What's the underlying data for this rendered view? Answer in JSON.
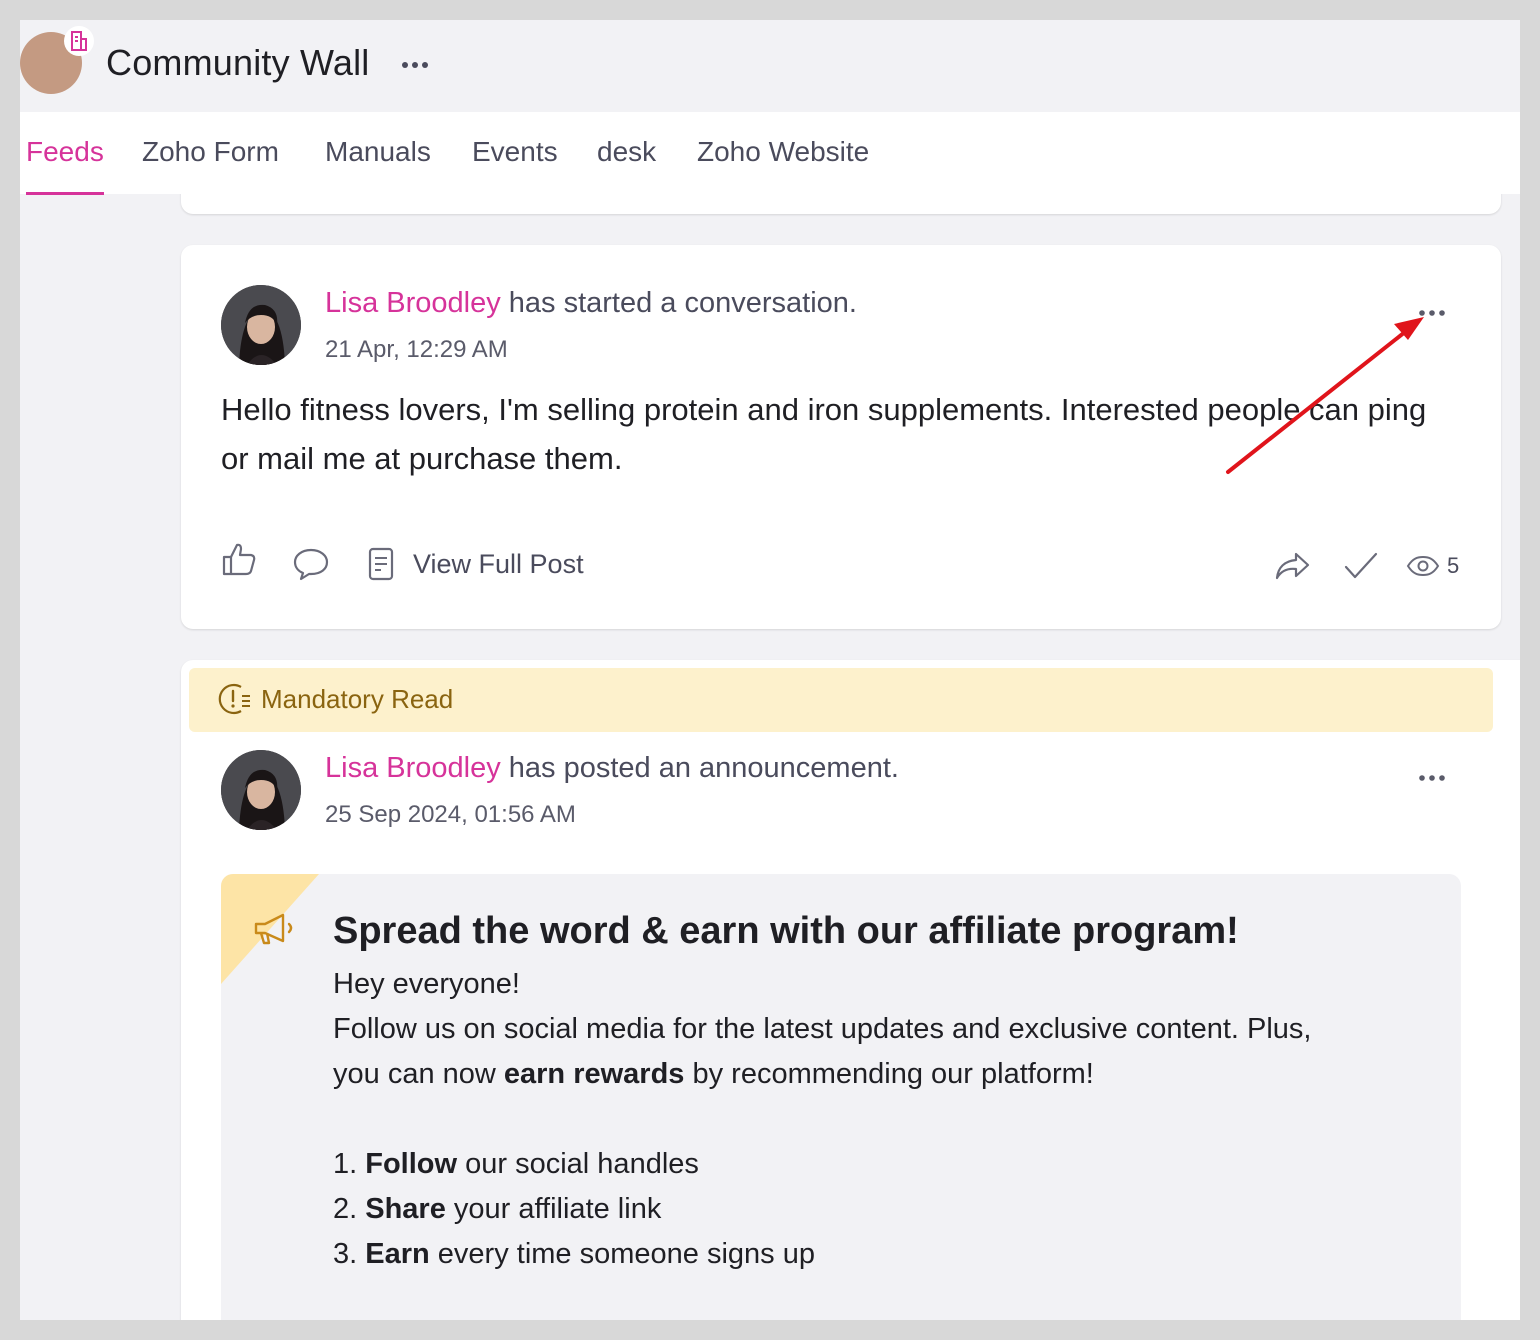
{
  "header": {
    "title": "Community Wall"
  },
  "tabs": [
    {
      "label": "Feeds",
      "active": true
    },
    {
      "label": "Zoho Form"
    },
    {
      "label": "Manuals"
    },
    {
      "label": "Events"
    },
    {
      "label": "desk"
    },
    {
      "label": "Zoho Website"
    }
  ],
  "post1": {
    "author": "Lisa Broodley",
    "action": " has started a conversation.",
    "time": "21 Apr, 12:29 AM",
    "body": "Hello fitness lovers, I'm selling protein and iron supplements. Interested people can ping or mail me at purchase them.",
    "view_full_label": "View Full Post",
    "view_count": "5"
  },
  "post2": {
    "badge": "Mandatory Read",
    "author": "Lisa Broodley",
    "action": " has posted an announcement.",
    "time": "25 Sep 2024, 01:56 AM",
    "announcement": {
      "title": "Spread the word & earn with our affiliate program!",
      "greeting": "Hey everyone!",
      "line1": "Follow us on social media for the latest updates and exclusive content. Plus,",
      "line2_pre": "you can now ",
      "line2_bold": "earn rewards",
      "line2_post": " by recommending our platform!",
      "steps": [
        {
          "num": "1. ",
          "bold": "Follow",
          "rest": " our social handles"
        },
        {
          "num": "2. ",
          "bold": "Share",
          "rest": " your affiliate link"
        },
        {
          "num": "3. ",
          "bold": "Earn",
          "rest": " every time someone signs up"
        }
      ]
    }
  },
  "colors": {
    "accent": "#d6339a",
    "mandatory_bg": "#fdf1cc",
    "mandatory_text": "#8a6410",
    "arrow": "#e0141b"
  }
}
